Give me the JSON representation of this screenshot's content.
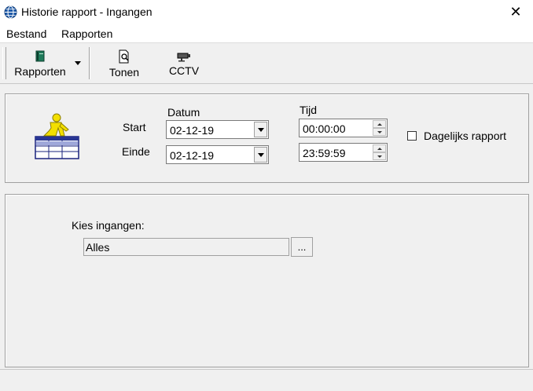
{
  "window": {
    "title": "Historie rapport - Ingangen",
    "close_glyph": "✕"
  },
  "menu": {
    "items": [
      "Bestand",
      "Rapporten"
    ]
  },
  "toolbar": {
    "buttons": [
      {
        "label": "Rapporten",
        "icon": "book-icon"
      },
      {
        "label": "Tonen",
        "icon": "preview-icon"
      },
      {
        "label": "CCTV",
        "icon": "camera-icon"
      }
    ]
  },
  "filters": {
    "datum_label": "Datum",
    "tijd_label": "Tijd",
    "start_label": "Start",
    "einde_label": "Einde",
    "start_date": "02-12-19",
    "end_date": "02-12-19",
    "start_time": "00:00:00",
    "end_time": "23:59:59",
    "daily_report_label": "Dagelijks rapport",
    "daily_report_checked": false
  },
  "entrances": {
    "label": "Kies ingangen:",
    "value": "Alles",
    "browse_label": "..."
  }
}
